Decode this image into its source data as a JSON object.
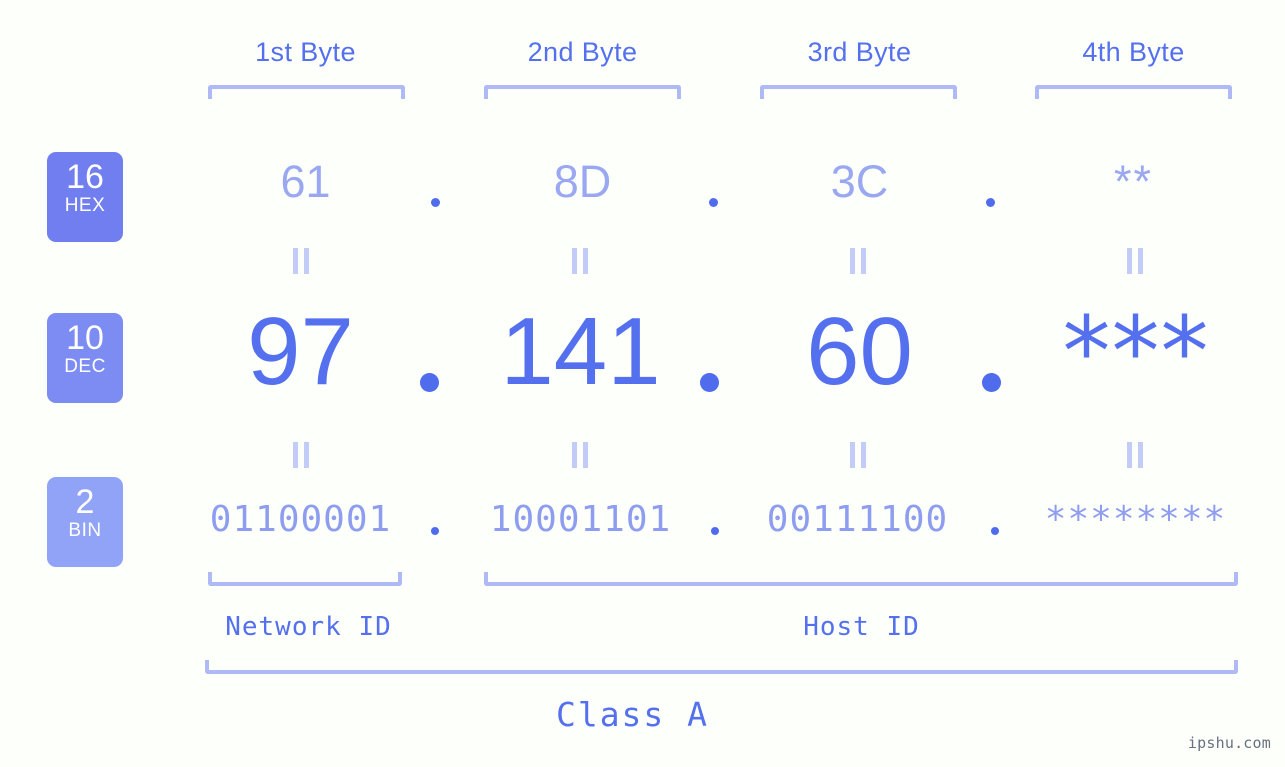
{
  "background_color": "#fdfffb",
  "colors": {
    "accent_strong": "#5570ee",
    "accent_light": "#9aa8f2",
    "bracket": "#aeb9f5",
    "badge_hex": "#717ef0",
    "badge_dec": "#7d8cf2",
    "badge_bin": "#91a3f7",
    "eq_mark": "#c3cbf7",
    "watermark": "#6a7080"
  },
  "byte_headers": [
    {
      "label": "1st Byte"
    },
    {
      "label": "2nd Byte"
    },
    {
      "label": "3rd Byte"
    },
    {
      "label": "4th Byte"
    }
  ],
  "rows": [
    {
      "key": "hex",
      "badge": {
        "number": "16",
        "name": "HEX"
      },
      "values": [
        "61",
        "8D",
        "3C",
        "**"
      ],
      "separators": [
        ".",
        ".",
        "."
      ]
    },
    {
      "key": "dec",
      "badge": {
        "number": "10",
        "name": "DEC"
      },
      "values": [
        "97",
        "141",
        "60",
        "***"
      ],
      "separators": [
        ".",
        ".",
        "."
      ]
    },
    {
      "key": "bin",
      "badge": {
        "number": "2",
        "name": "BIN"
      },
      "values": [
        "01100001",
        "10001101",
        "00111100",
        "********"
      ],
      "separators": [
        ".",
        ".",
        "."
      ]
    }
  ],
  "equivalence_mark": "‖",
  "id_sections": [
    {
      "label": "Network ID"
    },
    {
      "label": "Host ID"
    }
  ],
  "class_label": "Class A",
  "watermark": "ipshu.com"
}
